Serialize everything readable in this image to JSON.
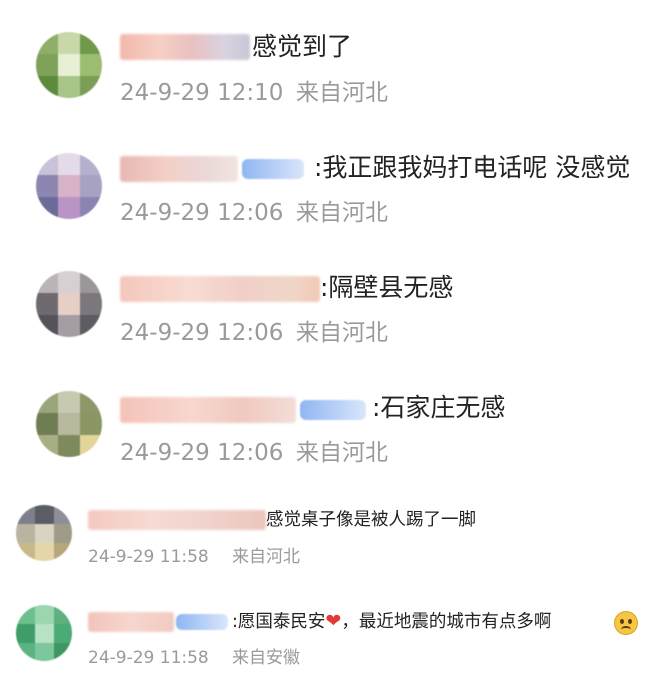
{
  "comments": [
    {
      "text": "感觉到了",
      "time": "24-9-29 12:10",
      "location": "来自河北"
    },
    {
      "text": ":我正跟我妈打电话呢 没感觉",
      "time": "24-9-29 12:06",
      "location": "来自河北"
    },
    {
      "text": ":隔壁县无感",
      "time": "24-9-29 12:06",
      "location": "来自河北"
    },
    {
      "text": ":石家庄无感",
      "time": "24-9-29 12:06",
      "location": "来自河北"
    },
    {
      "text": "感觉桌子像是被人踢了一脚",
      "time": "24-9-29 11:58",
      "location": "来自河北"
    },
    {
      "text_before": ":愿国泰民安",
      "text_after": "，最近地震的城市有点多啊",
      "time": "24-9-29 11:58",
      "location": "来自安徽",
      "emoji": [
        "heart-icon",
        "sad-face-icon"
      ],
      "heart_glyph": "❤"
    }
  ]
}
